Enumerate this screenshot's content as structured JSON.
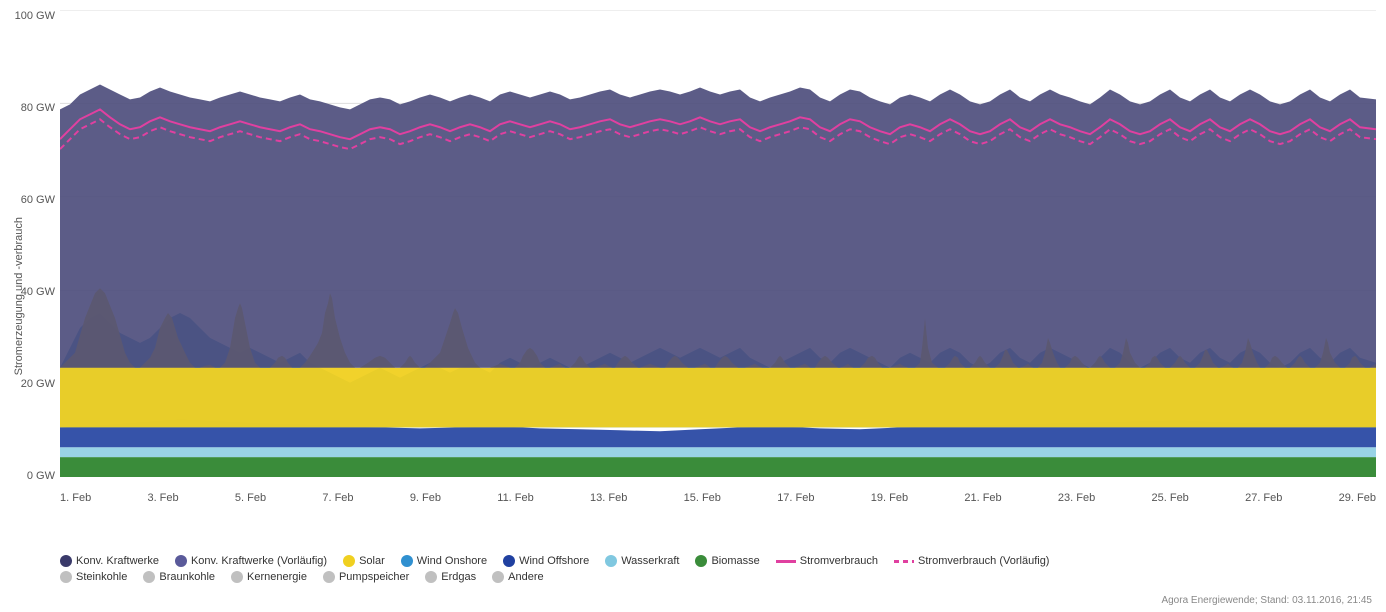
{
  "chart": {
    "title": "Stromerzeugung und -verbrauch",
    "y_axis_label": "Stromerzeugung und -verbrauch",
    "y_labels": [
      "100 GW",
      "80 GW",
      "60 GW",
      "40 GW",
      "20 GW",
      "0 GW"
    ],
    "x_labels": [
      "1. Feb",
      "3. Feb",
      "5. Feb",
      "7. Feb",
      "9. Feb",
      "11. Feb",
      "13. Feb",
      "15. Feb",
      "17. Feb",
      "19. Feb",
      "21. Feb",
      "23. Feb",
      "25. Feb",
      "27. Feb",
      "29. Feb"
    ],
    "footer": "Agora Energiewende; Stand: 03.11.2016, 21:45",
    "legend_row1": [
      {
        "id": "konv",
        "type": "dot",
        "color": "#3a3a6a",
        "label": "Konv. Kraftwerke"
      },
      {
        "id": "konv-vorl",
        "type": "dot",
        "color": "#5a5a9a",
        "label": "Konv. Kraftwerke (Vorläufig)"
      },
      {
        "id": "solar",
        "type": "dot",
        "color": "#f0d020",
        "label": "Solar"
      },
      {
        "id": "wind-onshore",
        "type": "dot",
        "color": "#3090d0",
        "label": "Wind Onshore"
      },
      {
        "id": "wind-offshore",
        "type": "dot",
        "color": "#2040a0",
        "label": "Wind Offshore"
      },
      {
        "id": "wasserkraft",
        "type": "dot",
        "color": "#80c8e0",
        "label": "Wasserkraft"
      },
      {
        "id": "biomasse",
        "type": "dot",
        "color": "#3a8c3a",
        "label": "Biomasse"
      },
      {
        "id": "stromverbrauch",
        "type": "line",
        "color": "#e040a0",
        "label": "Stromverbrauch"
      },
      {
        "id": "stromverbrauch-vorl",
        "type": "dashed",
        "color": "#e040a0",
        "label": "Stromverbrauch (Vorläufig)"
      }
    ],
    "legend_row2": [
      {
        "id": "steinkohle",
        "type": "dot",
        "color": "#c0c0c0",
        "label": "Steinkohle"
      },
      {
        "id": "braunkohle",
        "type": "dot",
        "color": "#c0c0c0",
        "label": "Braunkohle"
      },
      {
        "id": "kernenergie",
        "type": "dot",
        "color": "#c0c0c0",
        "label": "Kernenergie"
      },
      {
        "id": "pumpspeicher",
        "type": "dot",
        "color": "#c0c0c0",
        "label": "Pumpspeicher"
      },
      {
        "id": "erdgas",
        "type": "dot",
        "color": "#c0c0c0",
        "label": "Erdgas"
      },
      {
        "id": "andere",
        "type": "dot",
        "color": "#c0c0c0",
        "label": "Andere"
      }
    ]
  }
}
